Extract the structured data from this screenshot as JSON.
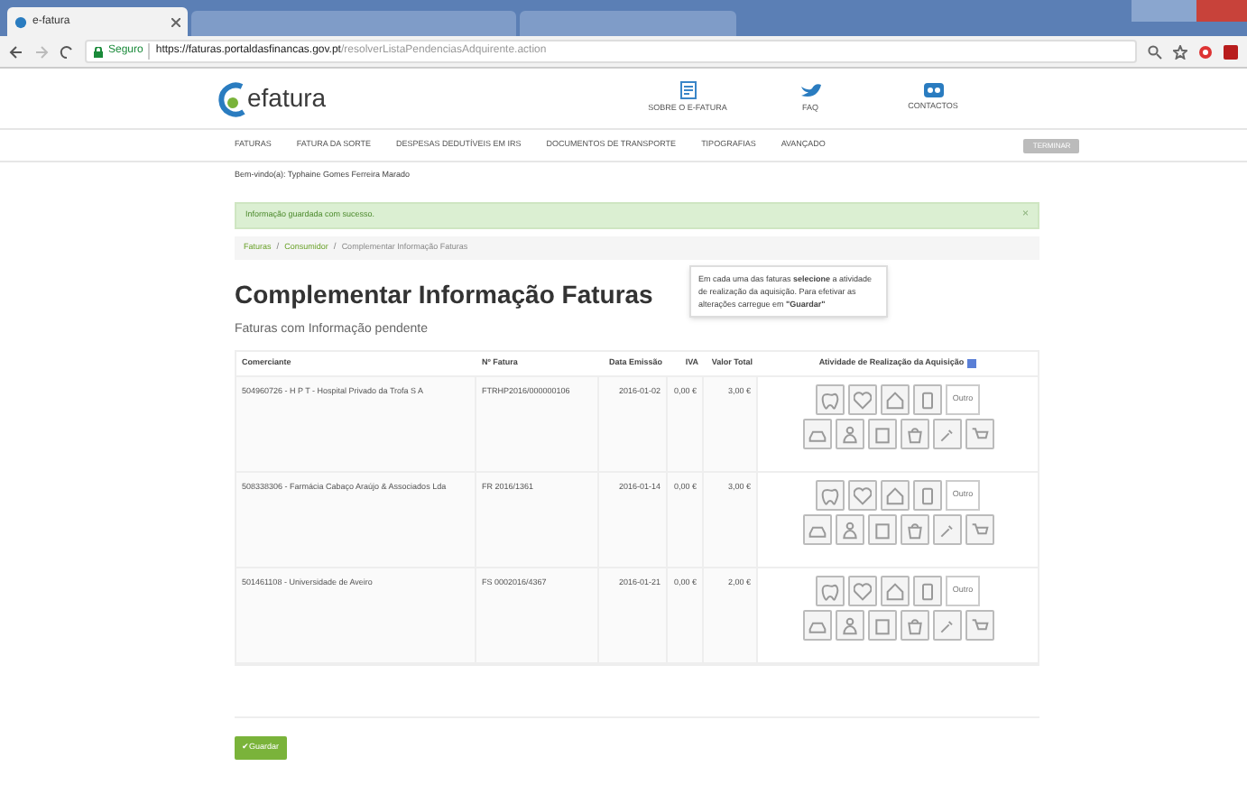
{
  "browser": {
    "tabs": [
      {
        "title": "e-fatura",
        "selected": true
      },
      {
        "selected": false
      },
      {
        "selected": false
      }
    ],
    "secure_label": "Seguro",
    "url_host": "https://faturas.portaldasfinancas.gov.pt",
    "url_path": "/resolverListaPendenciasAdquirente.action"
  },
  "header": {
    "logo": "efatura",
    "links": [
      {
        "label": "SOBRE O E-FATURA",
        "kind": "doc"
      },
      {
        "label": "FAQ",
        "kind": "bird"
      },
      {
        "label": "CONTACTOS",
        "kind": "mail"
      }
    ]
  },
  "nav": {
    "items": [
      {
        "label": "FATURAS",
        "selected": false
      },
      {
        "label": "FATURA DA SORTE",
        "selected": false
      },
      {
        "label": "DESPESAS DEDUTÍVEIS EM IRS",
        "selected": false
      },
      {
        "label": "DOCUMENTOS DE TRANSPORTE",
        "selected": false
      },
      {
        "label": "TIPOGRAFIAS",
        "selected": false
      },
      {
        "label": "AVANÇADO",
        "selected": false
      }
    ],
    "button": "TERMINAR"
  },
  "welcome": "Bem-vindo(a): Typhaine Gomes Ferreira Marado",
  "alert": {
    "text": "Informação guardada com sucesso.",
    "close": "×"
  },
  "breadcrumb": {
    "separator": "/",
    "items": [
      "Faturas",
      "Consumidor",
      "Complementar Informação Faturas"
    ]
  },
  "title": "Complementar Informação Faturas",
  "subtitle": "Faturas com Informação pendente",
  "tooltip": "Em cada uma das faturas **selecione** a atividade de realização da aquisição. Para efetivar as alterações carregue em **\"Guardar\"**",
  "table": {
    "columns": [
      "Comerciante",
      "Nº Fatura",
      "Data Emissão",
      "IVA",
      "Valor Total",
      "Atividade de Realização da Aquisição"
    ],
    "rows": [
      {
        "merchant": "504960726 - H P T - Hospital Privado da Trofa S A",
        "invoice": "FTRHP2016/000000106",
        "date": "2016-01-02",
        "vat": "0,00 €",
        "total": "3,00 €",
        "options": [
          {
            "selected": false
          },
          {
            "selected": false
          },
          {
            "selected": false
          },
          {
            "selected": false
          },
          {
            "selected": false
          },
          {
            "selected": false
          },
          {
            "selected": false
          },
          {
            "selected": false
          },
          {
            "selected": false
          },
          {
            "selected": false
          }
        ],
        "other": "Outro"
      },
      {
        "merchant": "508338306 - Farmácia Cabaço Araújo & Associados Lda",
        "invoice": "FR 2016/1361",
        "date": "2016-01-14",
        "vat": "0,00 €",
        "total": "3,00 €",
        "options": [
          {
            "selected": false
          },
          {
            "selected": false
          },
          {
            "selected": false
          },
          {
            "selected": false
          },
          {
            "selected": false
          },
          {
            "selected": false
          },
          {
            "selected": false
          },
          {
            "selected": false
          },
          {
            "selected": false
          },
          {
            "selected": false
          }
        ],
        "other": "Outro"
      },
      {
        "merchant": "501461108 - Universidade de Aveiro",
        "invoice": "FS 0002016/4367",
        "date": "2016-01-21",
        "vat": "0,00 €",
        "total": "2,00 €",
        "options": [
          {
            "selected": false
          },
          {
            "selected": false
          },
          {
            "selected": false
          },
          {
            "selected": false
          },
          {
            "selected": false
          },
          {
            "selected": false
          },
          {
            "selected": false
          },
          {
            "selected": false
          },
          {
            "selected": false
          },
          {
            "selected": false
          }
        ],
        "other": "Outro"
      }
    ]
  },
  "save_button": "✔Guardar"
}
